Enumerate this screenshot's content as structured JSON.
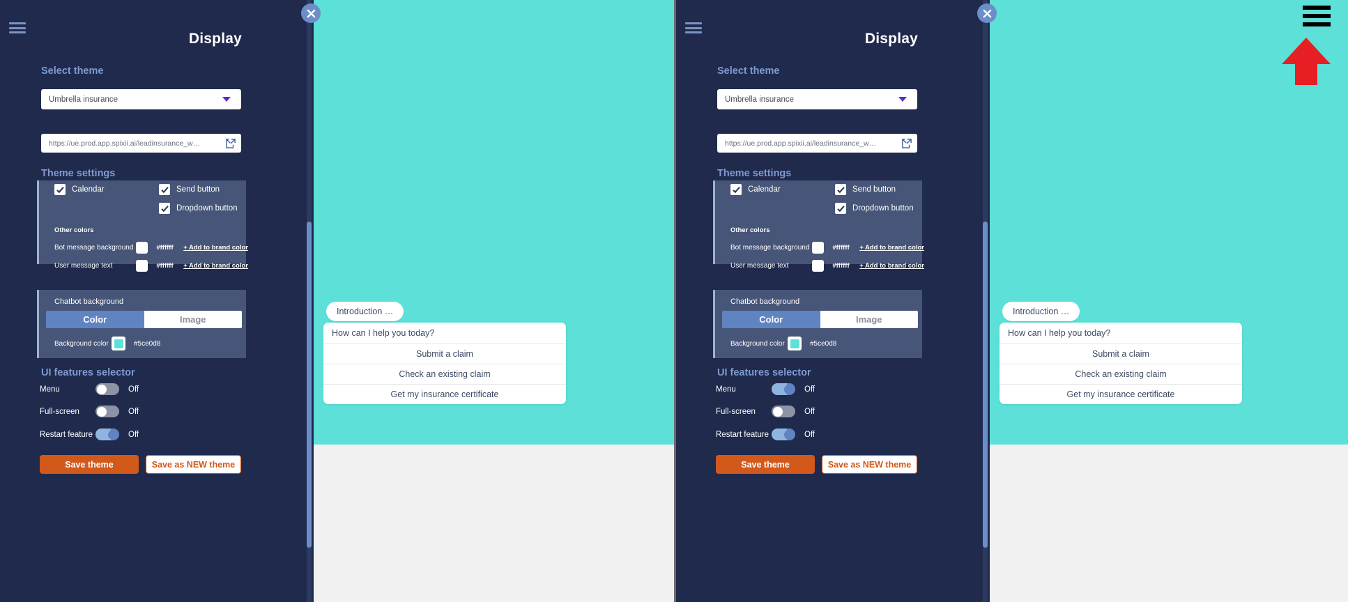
{
  "panel": {
    "title": "Display",
    "close_label": "close",
    "menu_icon": "hamburger-icon",
    "select_theme_heading": "Select theme",
    "theme_value": "Umbrella insurance",
    "url_value": "https://ue.prod.app.spixii.ai/leadinsurance_w…",
    "theme_settings_heading": "Theme settings",
    "checkboxes": [
      {
        "label": "Calendar",
        "checked": true
      },
      {
        "label": "Send button",
        "checked": true
      },
      {
        "label": "Dropdown button",
        "checked": true
      }
    ],
    "other_colors_title": "Other colors",
    "color_rows": [
      {
        "name": "Bot message background",
        "hex": "#ffffff",
        "swatch": "#ffffff",
        "add_link": "+ Add to brand color"
      },
      {
        "name": "User message text",
        "hex": "#ffffff",
        "swatch": "#ffffff",
        "add_link": "+ Add to brand color"
      }
    ],
    "chatbot_background_label": "Chatbot background",
    "segments": [
      {
        "label": "Color",
        "active": true
      },
      {
        "label": "Image",
        "active": false
      }
    ],
    "background_color_label": "Background color",
    "background_color_hex": "#5ce0d8",
    "ui_features_heading": "UI features selector",
    "features_left": [
      {
        "name": "Menu",
        "on": false,
        "state": "Off"
      },
      {
        "name": "Full-screen",
        "on": false,
        "state": "Off"
      },
      {
        "name": "Restart feature",
        "on": true,
        "state": "Off"
      }
    ],
    "features_right": [
      {
        "name": "Menu",
        "on": true,
        "state": "Off"
      },
      {
        "name": "Full-screen",
        "on": false,
        "state": "Off"
      },
      {
        "name": "Restart feature",
        "on": true,
        "state": "Off"
      }
    ],
    "save_label": "Save theme",
    "save_new_label": "Save as NEW theme"
  },
  "preview": {
    "background_color": "#5ce0d8",
    "intro_bubble": "Introduction …",
    "question": "How can I help you today?",
    "options": [
      "Submit a claim",
      "Check an existing claim",
      "Get my insurance certificate"
    ],
    "menu_icon": "hamburger-icon",
    "close_icon": "close-icon"
  },
  "annotation": {
    "arrow_color": "#e81e25",
    "points_to": "chatbot-menu-icon"
  },
  "colors": {
    "panel_bg": "#1f2a4d",
    "card_bg": "#465578",
    "accent_blue": "#6084c1",
    "heading_blue": "#7f9ad0",
    "orange": "#d2591a",
    "teal": "#5ce0d8"
  }
}
